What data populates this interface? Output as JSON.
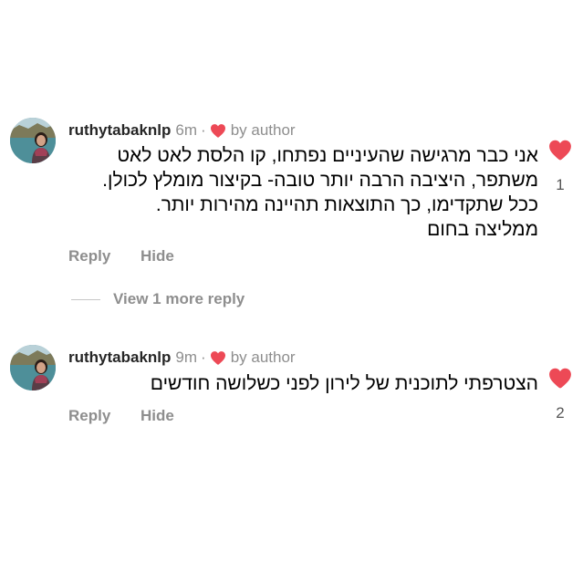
{
  "comments": [
    {
      "username": "ruthytabaknlp",
      "time": "6m",
      "separator": "·",
      "liked_by": "by author",
      "lines": [
        "אני כבר מרגישה שהעיניים נפתחו, קו הלסת לאט לאט",
        "משתפר, היציבה הרבה יותר טובה- בקיצור מומלץ לכולן.",
        "ככל שתקדימו, כך התוצאות תהיינה מהירות יותר.",
        "ממליצה בחום"
      ],
      "reply_label": "Reply",
      "hide_label": "Hide",
      "like_count": "1",
      "liked": true
    },
    {
      "username": "ruthytabaknlp",
      "time": "9m",
      "separator": "·",
      "liked_by": "by author",
      "lines": [
        "הצטרפתי לתוכנית של לירון לפני כשלושה חודשים"
      ],
      "reply_label": "Reply",
      "hide_label": "Hide",
      "like_count": "2",
      "liked": true
    }
  ],
  "view_more_replies": "View 1 more reply",
  "colors": {
    "heart": "#ed4956",
    "muted": "#8e8e8e",
    "username": "#262626"
  },
  "icons": {
    "like": "heart-icon",
    "author_like": "heart-icon"
  }
}
